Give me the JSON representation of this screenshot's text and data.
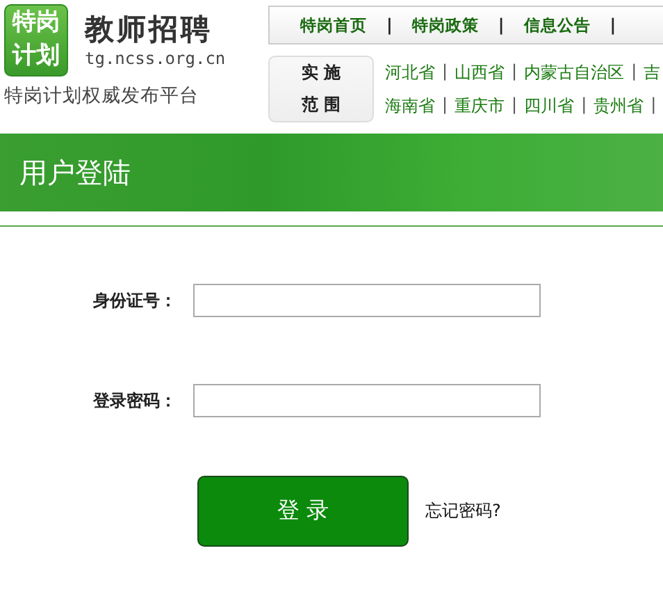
{
  "logo": {
    "badge_lines": [
      "特岗",
      "计划"
    ],
    "title": "教师招聘",
    "domain": "tg.ncss.org.cn",
    "tagline": "特岗计划权威发布平台"
  },
  "nav": [
    {
      "kind": "link",
      "text": "特岗首页"
    },
    {
      "kind": "separator",
      "text": "|"
    },
    {
      "kind": "link",
      "text": "特岗政策"
    },
    {
      "kind": "separator",
      "text": "|"
    },
    {
      "kind": "link",
      "text": "信息公告"
    },
    {
      "kind": "separator",
      "text": "|"
    }
  ],
  "regions": {
    "label_lines": [
      "实 施",
      "范 围"
    ],
    "first_line": [
      {
        "kind": "link",
        "text": "河北省"
      },
      {
        "kind": "separator",
        "text": "|"
      },
      {
        "kind": "link",
        "text": "山西省"
      },
      {
        "kind": "separator",
        "text": "|"
      },
      {
        "kind": "link",
        "text": "内蒙古自治区"
      },
      {
        "kind": "separator",
        "text": "|"
      },
      {
        "kind": "link",
        "text": "吉"
      }
    ],
    "second_line": [
      {
        "kind": "link",
        "text": "海南省"
      },
      {
        "kind": "separator",
        "text": "|"
      },
      {
        "kind": "link",
        "text": "重庆市"
      },
      {
        "kind": "separator",
        "text": "|"
      },
      {
        "kind": "link",
        "text": "四川省"
      },
      {
        "kind": "separator",
        "text": "|"
      },
      {
        "kind": "link",
        "text": "贵州省"
      },
      {
        "kind": "separator",
        "text": "|"
      }
    ]
  },
  "banner": {
    "title": "用户登陆"
  },
  "form": {
    "fields": [
      {
        "label": "身份证号："
      },
      {
        "label": "登录密码："
      }
    ],
    "submit": "登 录",
    "forgot": "忘记密码?"
  }
}
